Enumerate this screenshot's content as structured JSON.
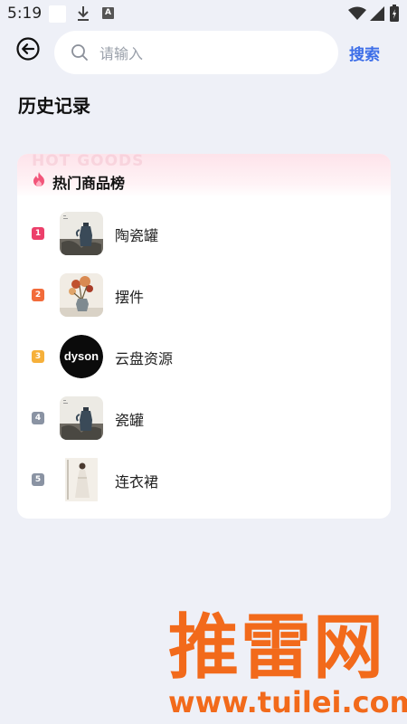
{
  "status_bar": {
    "time": "5:19",
    "a_icon": "A"
  },
  "search": {
    "placeholder": "请输入",
    "value": "",
    "button_label": "搜索"
  },
  "history": {
    "title": "历史记录"
  },
  "hot": {
    "watermark": "HOT GOODS",
    "title": "热门商品榜",
    "items": [
      {
        "rank": "1",
        "name": "陶瓷罐",
        "badge_color": "#ec3f6a",
        "image": "vase-image"
      },
      {
        "rank": "2",
        "name": "摆件",
        "badge_color": "#f26b3a",
        "image": "flower-vase-image"
      },
      {
        "rank": "3",
        "name": "云盘资源",
        "badge_color": "#f6b03a",
        "image": "dyson-logo"
      },
      {
        "rank": "4",
        "name": "瓷罐",
        "badge_color": "#8a93a3",
        "image": "vase-image"
      },
      {
        "rank": "5",
        "name": "连衣裙",
        "badge_color": "#8a93a3",
        "image": "dress-image"
      }
    ]
  },
  "logo_watermark": {
    "text": "推雷网",
    "url": "www.tuilei.com"
  }
}
